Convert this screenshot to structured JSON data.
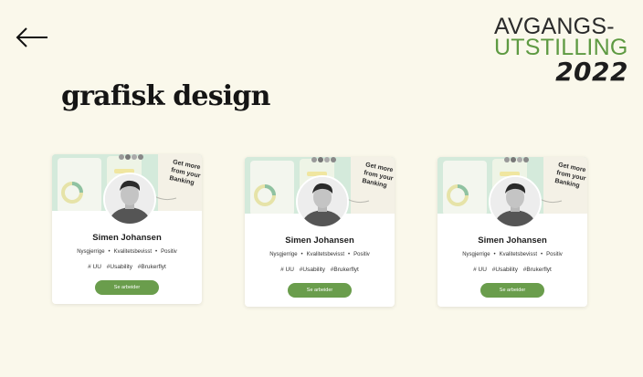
{
  "header": {
    "logo": {
      "line1": "AVGANGS-",
      "line2": "UTSTILLING",
      "line3": "2022"
    }
  },
  "page": {
    "title": "grafisk design"
  },
  "cover": {
    "headline": [
      "Get more",
      "from your",
      "Banking"
    ]
  },
  "cards": [
    {
      "name": "Simen Johansen",
      "traits": [
        "Nysgjerrige",
        "Kvalitetsbevisst",
        "Positiv"
      ],
      "tags": [
        "# UU",
        "#Usability",
        "#Brukerflyt"
      ],
      "button": "Se arbeider"
    },
    {
      "name": "Simen Johansen",
      "traits": [
        "Nysgjerrige",
        "Kvalitetsbevisst",
        "Positiv"
      ],
      "tags": [
        "# UU",
        "#Usability",
        "#Brukerflyt"
      ],
      "button": "Se arbeider"
    },
    {
      "name": "Simen Johansen",
      "traits": [
        "Nysgjerrige",
        "Kvalitetsbevisst",
        "Positiv"
      ],
      "tags": [
        "# UU",
        "#Usability",
        "#Brukerflyt"
      ],
      "button": "Se arbeider"
    }
  ],
  "colors": {
    "background": "#faf8eb",
    "accent": "#6a9d4c",
    "card": "#ffffff"
  }
}
